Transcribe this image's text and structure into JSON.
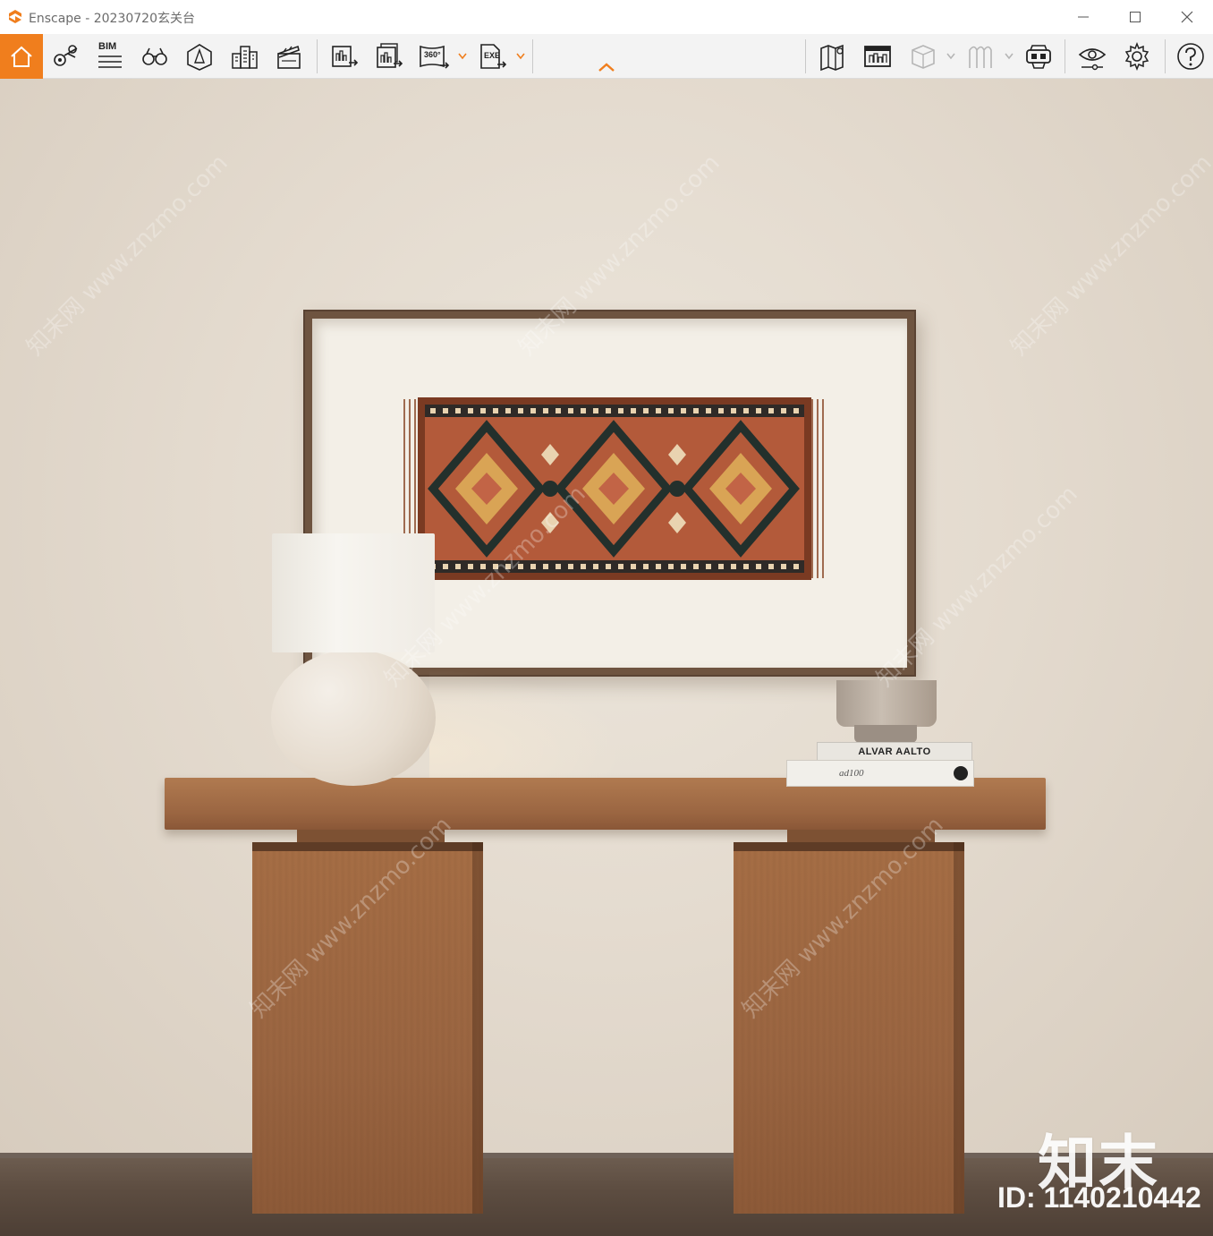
{
  "window": {
    "title": "Enscape - 20230720玄关台",
    "accent": "#f07e1d"
  },
  "toolbar": {
    "bim_label": "BIM",
    "panorama_label": "360°",
    "exe_label": "EXE",
    "icons": [
      "home-icon",
      "location-pin-icon",
      "bim-icon",
      "binoculars-icon",
      "perspective-icon",
      "buildings-icon",
      "clapperboard-icon",
      "screenshot-export-icon",
      "batch-export-icon",
      "panorama-icon",
      "exe-export-icon",
      "map-icon",
      "asset-library-icon",
      "cube-icon",
      "material-icon",
      "vr-headset-icon",
      "visual-settings-icon",
      "gear-icon",
      "help-icon"
    ]
  },
  "scene": {
    "book_top_title": "ALVAR AALTO",
    "book_bottom_title": "ad100"
  },
  "watermark": {
    "logo": "知末",
    "id_text": "ID: 1140210442",
    "diagonal": "知末网 www.znzmo.com"
  }
}
